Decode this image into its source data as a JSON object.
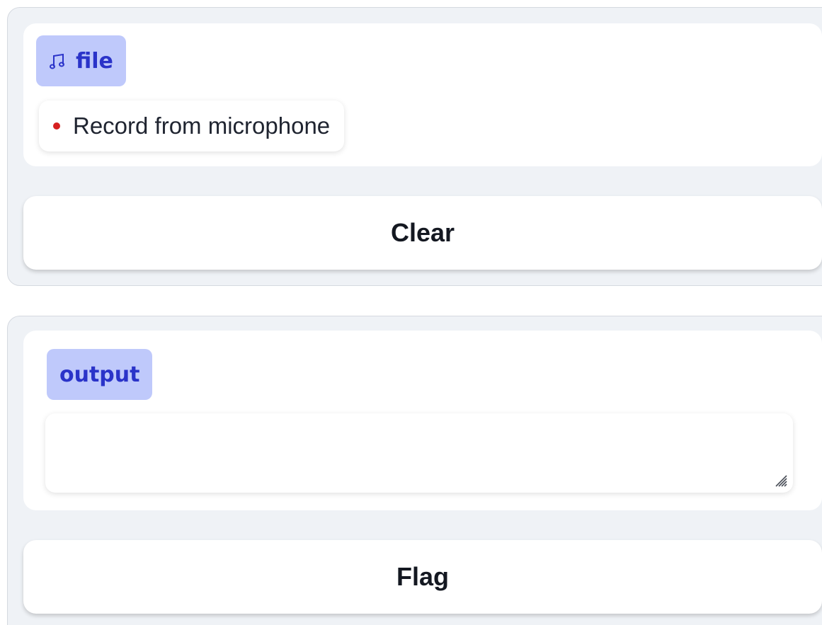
{
  "input_panel": {
    "badge_label": "file",
    "badge_icon": "music-note-icon",
    "record_label": "Record from microphone",
    "record_icon": "record-dot-icon",
    "clear_label": "Clear"
  },
  "output_panel": {
    "badge_label": "output",
    "textarea_value": "",
    "flag_label": "Flag"
  },
  "colors": {
    "badge_bg": "#bfc9fb",
    "badge_text": "#2a33c9",
    "panel_bg": "#eff2f6",
    "record_dot": "#d62020"
  }
}
